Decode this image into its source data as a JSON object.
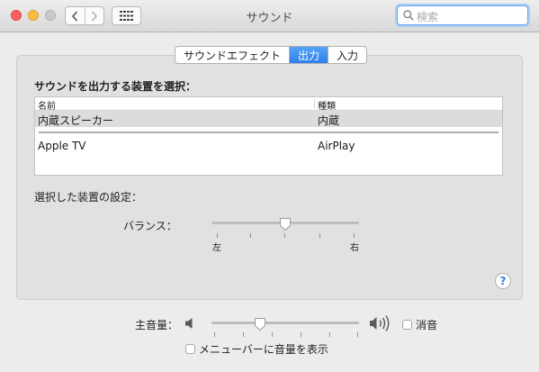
{
  "window": {
    "title": "サウンド"
  },
  "search": {
    "placeholder": "検索"
  },
  "tabs": [
    {
      "label": "サウンドエフェクト",
      "selected": false
    },
    {
      "label": "出力",
      "selected": true
    },
    {
      "label": "入力",
      "selected": false
    }
  ],
  "output": {
    "heading": "サウンドを出力する装置を選択：",
    "columns": [
      "名前",
      "種類"
    ],
    "devices": [
      {
        "name": "内蔵スピーカー",
        "type": "内蔵",
        "selected": true
      },
      {
        "name": "Apple TV",
        "type": "AirPlay",
        "selected": false
      }
    ]
  },
  "settings": {
    "label": "選択した装置の設定：",
    "balance": {
      "label": "バランス：",
      "left": "左",
      "right": "右",
      "value": 0.5
    }
  },
  "help": {
    "label": "?"
  },
  "volume": {
    "label": "主音量：",
    "value": 0.33,
    "mute_label": "消音",
    "mute_checked": false,
    "menubar_label": "メニューバーに音量を表示",
    "menubar_checked": false
  },
  "colors": {
    "accent": "#2f7fee",
    "close": "#fc605c",
    "minimize": "#fdbc40"
  },
  "icons": [
    "close-icon",
    "minimize-icon",
    "zoom-icon",
    "chevron-left-icon",
    "chevron-right-icon",
    "grid-icon",
    "search-icon",
    "speaker-low-icon",
    "speaker-high-icon",
    "help-icon"
  ]
}
